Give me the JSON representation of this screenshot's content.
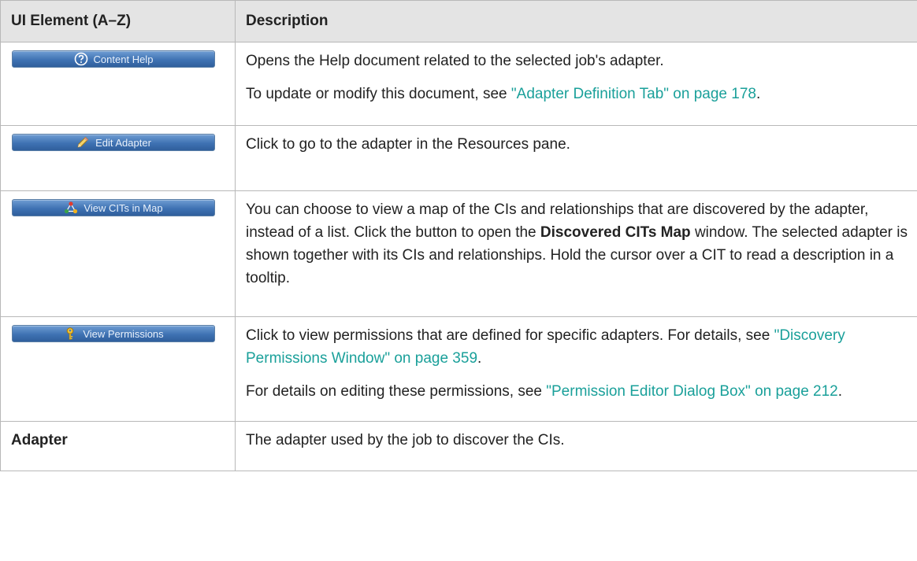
{
  "table": {
    "headers": [
      "UI Element (A–Z)",
      "Description"
    ],
    "rows": [
      {
        "element": {
          "type": "button",
          "label": "Content Help",
          "icon": "question-help-icon"
        },
        "paragraphs": [
          {
            "text": "Opens the Help document related to the selected job's adapter."
          },
          {
            "before": "To update or modify this document, see ",
            "link": "\"Adapter Definition Tab\" on page 178",
            "after": "."
          }
        ]
      },
      {
        "element": {
          "type": "button",
          "label": "Edit Adapter",
          "icon": "pencil-icon"
        },
        "paragraphs": [
          {
            "text": "Click to go to the adapter in the Resources pane."
          }
        ]
      },
      {
        "element": {
          "type": "button",
          "label": "View CITs in Map",
          "icon": "topology-map-icon"
        },
        "paragraphs": [
          {
            "before": "You can choose to view a map of the CIs and relationships that are discovered by the adapter, instead of a list. Click the button to open the ",
            "bold": "Discovered CITs Map",
            "after": " window. The selected adapter is shown together with its CIs and relationships. Hold the cursor over a CIT to read a description in a tooltip."
          }
        ]
      },
      {
        "element": {
          "type": "button",
          "label": "View Permissions",
          "icon": "key-icon"
        },
        "paragraphs": [
          {
            "before": "Click to view permissions that are defined for specific adapters. For details, see ",
            "link": "\"Discovery Permissions Window\" on page 359",
            "after": "."
          },
          {
            "before": "For details on editing these permissions, see ",
            "link": "\"Permission Editor Dialog Box\" on page 212",
            "after": "."
          }
        ]
      },
      {
        "element": {
          "type": "text",
          "label": "Adapter"
        },
        "paragraphs": [
          {
            "text": "The adapter used by the job to discover the CIs."
          }
        ]
      }
    ]
  },
  "colors": {
    "header_bg": "#e4e4e4",
    "link": "#1aa09a",
    "button": "#4a7cbb",
    "border": "#b8b8b8"
  }
}
